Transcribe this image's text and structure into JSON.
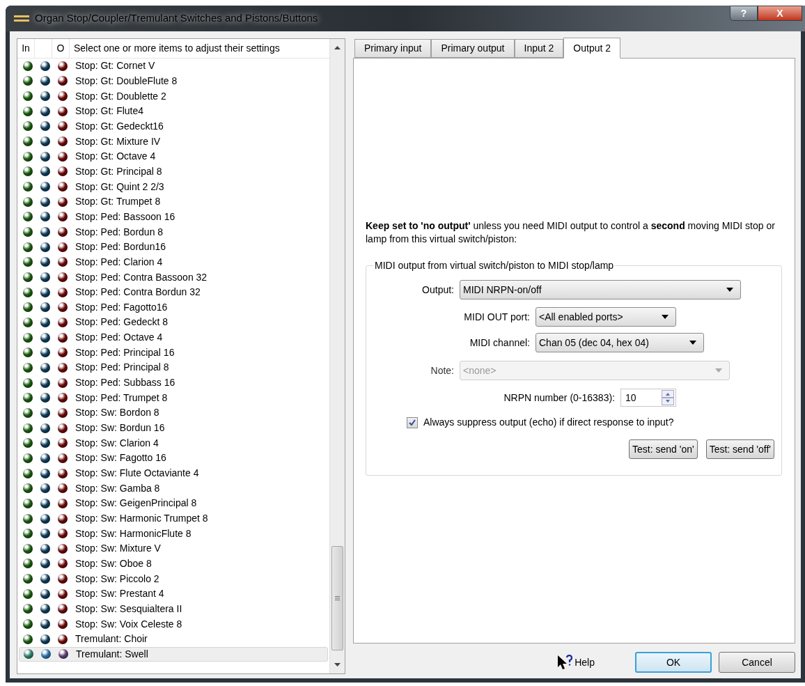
{
  "window": {
    "title": "Organ Stop/Coupler/Tremulant Switches and Pistons/Buttons",
    "help_glyph": "?",
    "close_glyph": "X"
  },
  "list": {
    "columns": [
      "In",
      "",
      "O",
      "Select one or more items to adjust their settings"
    ],
    "items": [
      {
        "label": "Stop: Gt: Cornet V",
        "selected": false
      },
      {
        "label": "Stop: Gt: DoubleFlute 8",
        "selected": false
      },
      {
        "label": "Stop: Gt: Doublette 2",
        "selected": false
      },
      {
        "label": "Stop: Gt: Flute4",
        "selected": false
      },
      {
        "label": "Stop: Gt: Gedeckt16",
        "selected": false
      },
      {
        "label": "Stop: Gt: Mixture IV",
        "selected": false
      },
      {
        "label": "Stop: Gt: Octave 4",
        "selected": false
      },
      {
        "label": "Stop: Gt: Principal 8",
        "selected": false
      },
      {
        "label": "Stop: Gt: Quint 2 2/3",
        "selected": false
      },
      {
        "label": "Stop: Gt: Trumpet 8",
        "selected": false
      },
      {
        "label": "Stop: Ped: Bassoon 16",
        "selected": false
      },
      {
        "label": "Stop: Ped: Bordun 8",
        "selected": false
      },
      {
        "label": "Stop: Ped: Bordun16",
        "selected": false
      },
      {
        "label": "Stop: Ped: Clarion 4",
        "selected": false
      },
      {
        "label": "Stop: Ped: Contra Bassoon 32",
        "selected": false
      },
      {
        "label": "Stop: Ped: Contra Bordun 32",
        "selected": false
      },
      {
        "label": "Stop: Ped: Fagotto16",
        "selected": false
      },
      {
        "label": "Stop: Ped: Gedeckt 8",
        "selected": false
      },
      {
        "label": "Stop: Ped: Octave 4",
        "selected": false
      },
      {
        "label": "Stop: Ped: Principal 16",
        "selected": false
      },
      {
        "label": "Stop: Ped: Principal 8",
        "selected": false
      },
      {
        "label": "Stop: Ped: Subbass 16",
        "selected": false
      },
      {
        "label": "Stop: Ped: Trumpet 8",
        "selected": false
      },
      {
        "label": "Stop: Sw: Bordon 8",
        "selected": false
      },
      {
        "label": "Stop: Sw: Bordun 16",
        "selected": false
      },
      {
        "label": "Stop: Sw: Clarion 4",
        "selected": false
      },
      {
        "label": "Stop: Sw: Fagotto 16",
        "selected": false
      },
      {
        "label": "Stop: Sw: Flute Octaviante 4",
        "selected": false
      },
      {
        "label": "Stop: Sw: Gamba 8",
        "selected": false
      },
      {
        "label": "Stop: Sw: GeigenPrincipal 8",
        "selected": false
      },
      {
        "label": "Stop: Sw: Harmonic Trumpet 8",
        "selected": false
      },
      {
        "label": "Stop: Sw: HarmonicFlute 8",
        "selected": false
      },
      {
        "label": "Stop: Sw: Mixture V",
        "selected": false
      },
      {
        "label": "Stop: Sw: Oboe 8",
        "selected": false
      },
      {
        "label": "Stop: Sw: Piccolo 2",
        "selected": false
      },
      {
        "label": "Stop: Sw: Prestant 4",
        "selected": false
      },
      {
        "label": "Stop: Sw: Sesquialtera II",
        "selected": false
      },
      {
        "label": "Stop: Sw: Voix Celeste 8",
        "selected": false
      },
      {
        "label": "Tremulant: Choir",
        "selected": false
      },
      {
        "label": "Tremulant: Swell",
        "selected": true
      }
    ]
  },
  "tabs": [
    {
      "label": "Primary input",
      "selected": false
    },
    {
      "label": "Primary output",
      "selected": false
    },
    {
      "label": "Input 2",
      "selected": false
    },
    {
      "label": "Output 2",
      "selected": true
    }
  ],
  "help_text": "**Keep set to 'no output'** unless you need MIDI output to control a **second** moving MIDI stop or lamp from this virtual switch/piston:",
  "group": {
    "title": "MIDI output from virtual switch/piston to MIDI stop/lamp",
    "output": {
      "label": "Output:",
      "value": "MIDI NRPN-on/off"
    },
    "port": {
      "label": "MIDI OUT port:",
      "value": "<All enabled ports>"
    },
    "channel": {
      "label": "MIDI channel:",
      "value": "Chan 05 (dec 04, hex 04)"
    },
    "note": {
      "label": "Note:",
      "value": "<none>",
      "disabled": true
    },
    "nrpn": {
      "label": "NRPN number (0-16383):",
      "value": "10"
    },
    "suppress": {
      "label": "Always suppress output (echo) if direct response to input?",
      "checked": true
    },
    "buttons": [
      "Test: send 'on'",
      "Test: send 'off'"
    ]
  },
  "footer": {
    "help": "Help",
    "ok": "OK",
    "cancel": "Cancel"
  }
}
